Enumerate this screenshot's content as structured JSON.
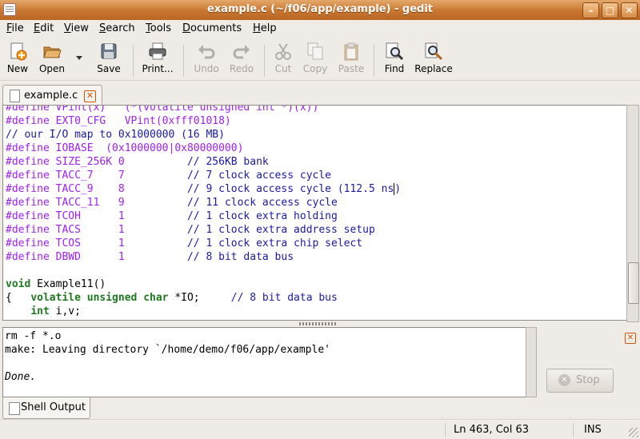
{
  "window": {
    "title": "example.c (~/f06/app/example) - gedit"
  },
  "menubar": [
    {
      "label": "File",
      "underline": "F",
      "rest": "ile"
    },
    {
      "label": "Edit",
      "underline": "E",
      "rest": "dit"
    },
    {
      "label": "View",
      "underline": "V",
      "rest": "iew"
    },
    {
      "label": "Search",
      "underline": "S",
      "rest": "earch"
    },
    {
      "label": "Tools",
      "underline": "T",
      "rest": "ools"
    },
    {
      "label": "Documents",
      "underline": "D",
      "rest": "ocuments"
    },
    {
      "label": "Help",
      "underline": "H",
      "rest": "elp"
    }
  ],
  "toolbar": {
    "new": "New",
    "open": "Open",
    "save": "Save",
    "print": "Print...",
    "undo": "Undo",
    "redo": "Redo",
    "cut": "Cut",
    "copy": "Copy",
    "paste": "Paste",
    "find": "Find",
    "replace": "Replace"
  },
  "tab": {
    "label": "example.c"
  },
  "editor": {
    "lines": [
      {
        "text": "#define VPint(x)   (*(volatile unsigned int *)(x))",
        "kind": "pp"
      },
      {
        "text": "#define EXT0_CFG   VPint(0xfff01018)",
        "kind": "pp"
      },
      {
        "text": "// our I/O map to 0x1000000 (16 MB)",
        "kind": "cm"
      },
      {
        "text": "#define IOBASE  (0x1000000|0x80000000)",
        "kind": "pp"
      },
      {
        "pp": "#define SIZE_256K 0          ",
        "cm": "// 256KB bank"
      },
      {
        "pp": "#define TACC_7    7          ",
        "cm": "// 7 clock access cycle"
      },
      {
        "pp": "#define TACC_9    8          ",
        "cm": "// 9 clock access cycle (112.5 ns",
        "cursor": true
      },
      {
        "pp": "#define TACC_11   9          ",
        "cm": "// 11 clock access cycle"
      },
      {
        "pp": "#define TCOH      1          ",
        "cm": "// 1 clock extra holding"
      },
      {
        "pp": "#define TACS      1          ",
        "cm": "// 1 clock extra address setup"
      },
      {
        "pp": "#define TCOS      1          ",
        "cm": "// 1 clock extra chip select"
      },
      {
        "pp": "#define DBWD      1          ",
        "cm": "// 8 bit data bus"
      },
      {
        "text": "",
        "kind": "plain"
      },
      {
        "kw": "void",
        "rest": " Example11()"
      },
      {
        "plain": "{   ",
        "kw": "volatile unsigned char",
        "rest": " *IO;     ",
        "cm": "// 8 bit data bus"
      },
      {
        "plain": "    ",
        "kw": "int",
        "rest": " i,v;"
      }
    ]
  },
  "output": {
    "lines": [
      {
        "text": "rm -f *.o",
        "italic": false
      },
      {
        "text": "make: Leaving directory `/home/demo/f06/app/example'",
        "italic": false
      },
      {
        "text": "",
        "italic": false
      },
      {
        "text": "Done.",
        "italic": true
      }
    ],
    "stop_label": "Stop",
    "panel_tab": "Shell Output"
  },
  "status": {
    "position": "Ln 463, Col 63",
    "mode": "INS"
  },
  "colors": {
    "titlebar": "#c8762f",
    "preprocessor": "#a020f0",
    "comment": "#1a1aa6",
    "keyword": "#1f7a1f"
  }
}
